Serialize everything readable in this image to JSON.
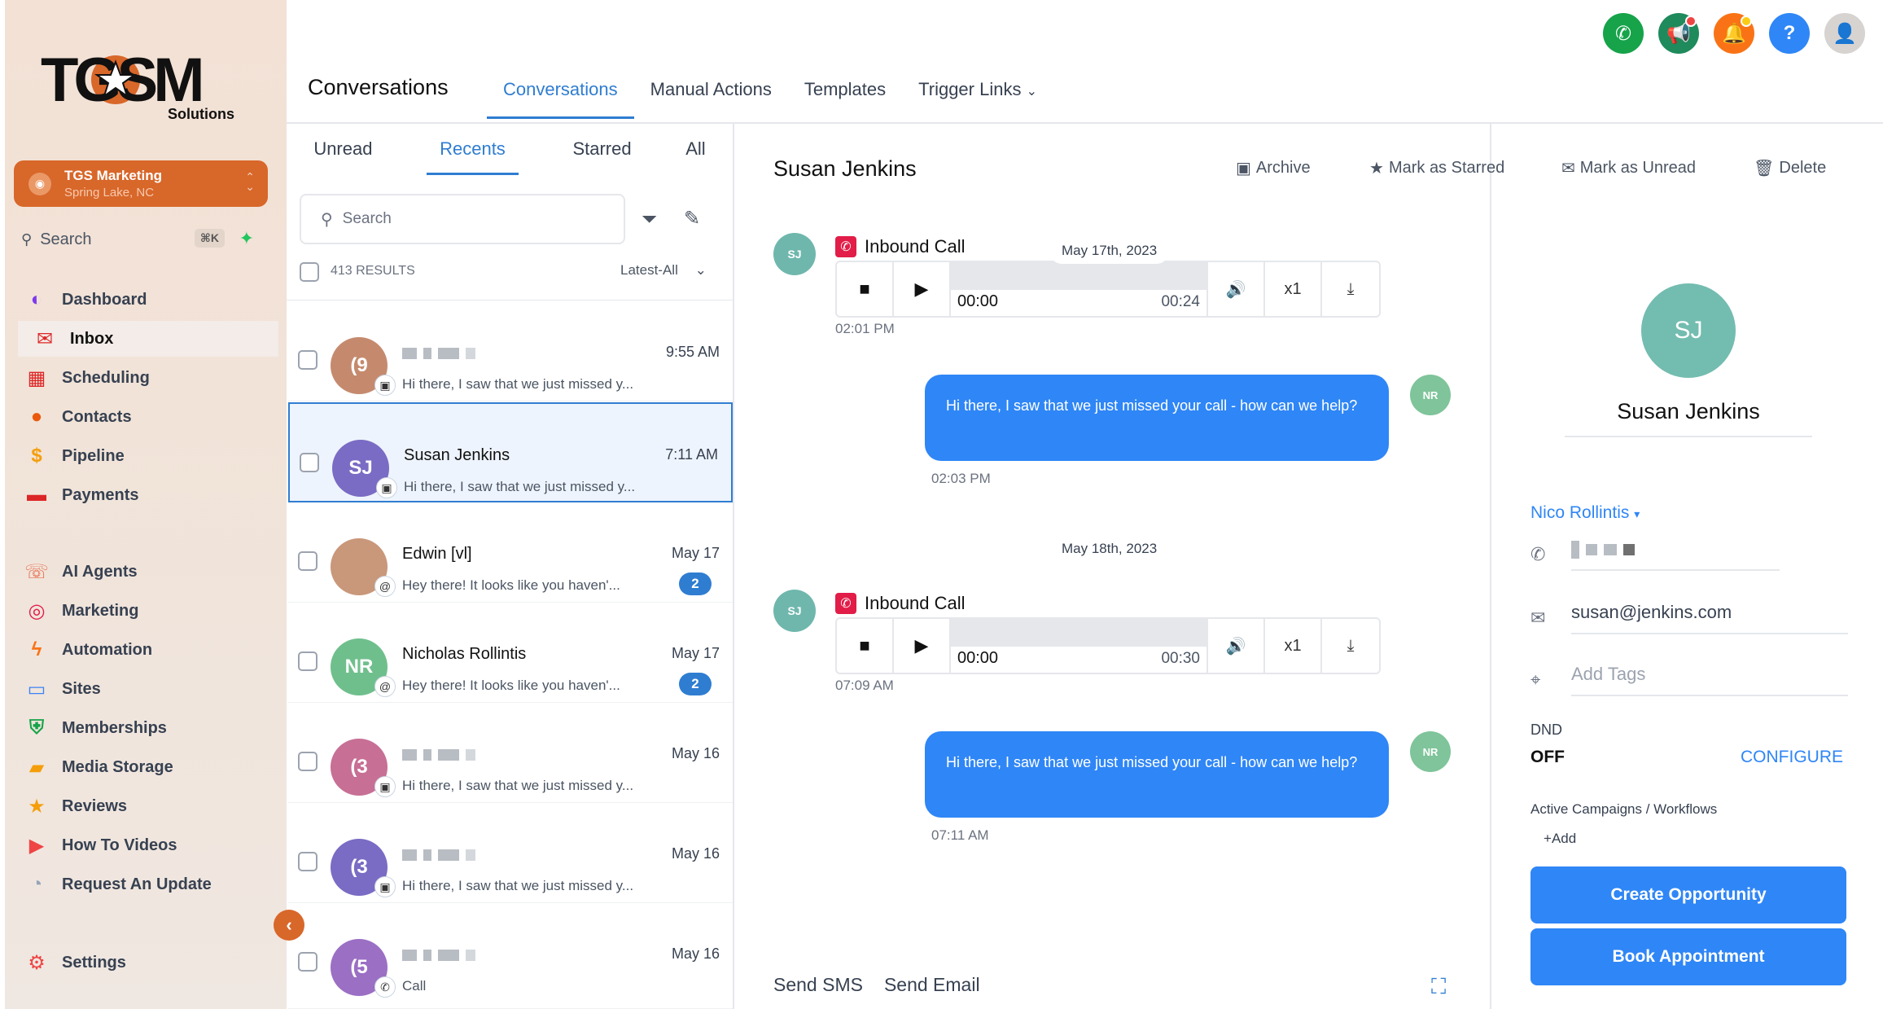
{
  "brand": {
    "logo_text": "TGSM",
    "logo_sub": "Solutions"
  },
  "location": {
    "name": "TGS Marketing",
    "place": "Spring Lake, NC"
  },
  "sidebar_search": {
    "label": "Search",
    "shortcut": "⌘K"
  },
  "nav": [
    {
      "label": "Dashboard",
      "icon": "dashboard-icon",
      "color": "#7c3aed"
    },
    {
      "label": "Inbox",
      "icon": "inbox-icon",
      "color": "#dc2626"
    },
    {
      "label": "Scheduling",
      "icon": "calendar-icon",
      "color": "#dc2626"
    },
    {
      "label": "Contacts",
      "icon": "contacts-icon",
      "color": "#ea580c"
    },
    {
      "label": "Pipeline",
      "icon": "pipeline-icon",
      "color": "#f59e0b"
    },
    {
      "label": "Payments",
      "icon": "payments-icon",
      "color": "#dc2626"
    },
    {
      "label": "AI Agents",
      "icon": "ai-agents-icon",
      "color": "#e76f51"
    },
    {
      "label": "Marketing",
      "icon": "marketing-icon",
      "color": "#e11d48"
    },
    {
      "label": "Automation",
      "icon": "automation-icon",
      "color": "#f97316"
    },
    {
      "label": "Sites",
      "icon": "sites-icon",
      "color": "#3b82f6"
    },
    {
      "label": "Memberships",
      "icon": "memberships-icon",
      "color": "#16a34a"
    },
    {
      "label": "Media Storage",
      "icon": "folder-icon",
      "color": "#f59e0b"
    },
    {
      "label": "Reviews",
      "icon": "star-icon",
      "color": "#f59e0b"
    },
    {
      "label": "How To Videos",
      "icon": "play-icon",
      "color": "#ef4444"
    },
    {
      "label": "Request An Update",
      "icon": "user-icon",
      "color": "#94a3b8"
    },
    {
      "label": "Settings",
      "icon": "gear-icon",
      "color": "#ef4444"
    }
  ],
  "header": {
    "title": "Conversations",
    "tabs": [
      "Conversations",
      "Manual Actions",
      "Templates",
      "Trigger Links"
    ]
  },
  "list": {
    "tabs": [
      "Unread",
      "Recents",
      "Starred",
      "All"
    ],
    "search_placeholder": "Search",
    "results": "413 RESULTS",
    "sort": "Latest-All",
    "items": [
      {
        "initials": "(9",
        "name": "",
        "time": "9:55 AM",
        "preview": "Hi there, I saw that we just missed y...",
        "count": "",
        "color": "#c58a6e",
        "channel": "sms"
      },
      {
        "initials": "SJ",
        "name": "Susan Jenkins",
        "time": "7:11 AM",
        "preview": "Hi there, I saw that we just missed y...",
        "count": "",
        "color": "#7a6bc4",
        "channel": "sms"
      },
      {
        "initials": "",
        "name": "Edwin [vl]",
        "time": "May 17",
        "preview": "Hey there! It looks like you haven'...",
        "count": "2",
        "color": "#c9977a",
        "channel": "email"
      },
      {
        "initials": "NR",
        "name": "Nicholas Rollintis",
        "time": "May 17",
        "preview": "Hey there! It looks like you haven'...",
        "count": "2",
        "color": "#6fbf8c",
        "channel": "email"
      },
      {
        "initials": "(3",
        "name": "",
        "time": "May 16",
        "preview": "Hi there, I saw that we just missed y...",
        "count": "",
        "color": "#c76f95",
        "channel": "sms"
      },
      {
        "initials": "(3",
        "name": "",
        "time": "May 16",
        "preview": "Hi there, I saw that we just missed y...",
        "count": "",
        "color": "#7a6bc4",
        "channel": "sms"
      },
      {
        "initials": "(5",
        "name": "",
        "time": "May 16",
        "preview": "Call",
        "count": "",
        "color": "#9b6fc4",
        "channel": "call"
      }
    ]
  },
  "chat": {
    "name": "Susan Jenkins",
    "actions": [
      "Archive",
      "Mark as Starred",
      "Mark as Unread",
      "Delete"
    ],
    "avatar": "SJ",
    "user_avatar": "NR",
    "call_label": "Inbound Call",
    "date1": "May 17th, 2023",
    "date2": "May 18th, 2023",
    "call1": {
      "elapsed": "00:00",
      "duration": "00:24",
      "speed": "x1",
      "time": "02:01 PM"
    },
    "msg1": {
      "text": "Hi there, I saw that we just missed your call - how can we help?",
      "time": "02:03 PM"
    },
    "call2": {
      "elapsed": "00:00",
      "duration": "00:30",
      "speed": "x1",
      "time": "07:09 AM"
    },
    "msg2": {
      "text": "Hi there, I saw that we just missed your call - how can we help?",
      "time": "07:11 AM"
    },
    "send_sms": "Send SMS",
    "send_email": "Send Email"
  },
  "contact": {
    "initials": "SJ",
    "name": "Susan Jenkins",
    "owner": "Nico Rollintis",
    "email": "susan@jenkins.com",
    "tags_placeholder": "Add Tags",
    "dnd_label": "DND",
    "dnd_value": "OFF",
    "configure": "CONFIGURE",
    "campaigns_label": "Active Campaigns / Workflows",
    "add": "Add",
    "create_opportunity": "Create Opportunity",
    "book_appointment": "Book Appointment"
  },
  "colors": {
    "accent": "#2f7dd1",
    "brand": "#d8672a",
    "bubble": "#2f86f6"
  }
}
